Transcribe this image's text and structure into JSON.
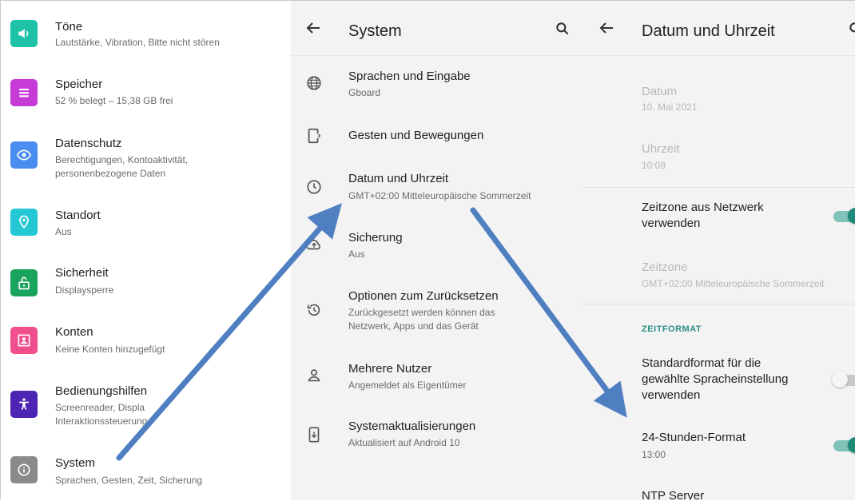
{
  "left": {
    "items": [
      {
        "title": "Töne",
        "subtitle": "Lautstärke, Vibration, Bitte nicht stören",
        "icon": "volume-icon",
        "color": "#1ec2a6"
      },
      {
        "title": "Speicher",
        "subtitle": "52 % belegt – 15,38 GB frei",
        "icon": "storage-icon",
        "color": "#c63ad6"
      },
      {
        "title": "Datenschutz",
        "subtitle": "Berechtigungen, Kontoaktivität,\npersonenbezogene Daten",
        "icon": "privacy-eye-icon",
        "color": "#4a8df0"
      },
      {
        "title": "Standort",
        "subtitle": "Aus",
        "icon": "location-pin-icon",
        "color": "#24c7d4"
      },
      {
        "title": "Sicherheit",
        "subtitle": "Displaysperre",
        "icon": "lock-open-icon",
        "color": "#1aa35c"
      },
      {
        "title": "Konten",
        "subtitle": "Keine Konten hinzugefügt",
        "icon": "account-box-icon",
        "color": "#ef4f8c"
      },
      {
        "title": "Bedienungshilfen",
        "subtitle": "Screenreader, Displa\nInteraktionssteuerung",
        "icon": "accessibility-icon",
        "color": "#4d24b3"
      },
      {
        "title": "System",
        "subtitle": "Sprachen, Gesten, Zeit, Sicherung",
        "icon": "info-icon",
        "color": "#8a8a8a"
      }
    ]
  },
  "middle": {
    "title": "System",
    "items": [
      {
        "title": "Sprachen und Eingabe",
        "subtitle": "Gboard",
        "icon": "globe-icon"
      },
      {
        "title": "Gesten und Bewegungen",
        "subtitle": "",
        "icon": "gesture-phone-icon"
      },
      {
        "title": "Datum und Uhrzeit",
        "subtitle": "GMT+02:00 Mitteleuropäische Sommerzeit",
        "icon": "clock-icon"
      },
      {
        "title": "Sicherung",
        "subtitle": "Aus",
        "icon": "backup-cloud-icon"
      },
      {
        "title": "Optionen zum Zurücksetzen",
        "subtitle": "Zurückgesetzt werden können das\nNetzwerk, Apps und das Gerät",
        "icon": "history-icon"
      },
      {
        "title": "Mehrere Nutzer",
        "subtitle": "Angemeldet als Eigentümer",
        "icon": "person-icon"
      },
      {
        "title": "Systemaktualisierungen",
        "subtitle": "Aktualisiert auf Android 10",
        "icon": "system-update-icon"
      }
    ]
  },
  "right": {
    "title": "Datum und Uhrzeit",
    "datum": {
      "title": "Datum",
      "subtitle": "10. Mai 2021"
    },
    "uhrzeit": {
      "title": "Uhrzeit",
      "subtitle": "10:08"
    },
    "zeitzone_netz": {
      "title": "Zeitzone aus Netzwerk\nverwenden",
      "toggle": "on"
    },
    "zeitzone": {
      "title": "Zeitzone",
      "subtitle": "GMT+02:00 Mitteleuropäische Sommerzeit"
    },
    "section": "ZEITFORMAT",
    "standardformat": {
      "title": "Standardformat für die\ngewählte Spracheinstellung\nverwenden",
      "toggle": "off"
    },
    "format24": {
      "title": "24-Stunden-Format",
      "subtitle": "13:00",
      "toggle": "on"
    },
    "ntp": {
      "title": "NTP Server"
    }
  },
  "colors": {
    "accent": "#1e8a78",
    "arrow": "#4f7fc1"
  }
}
